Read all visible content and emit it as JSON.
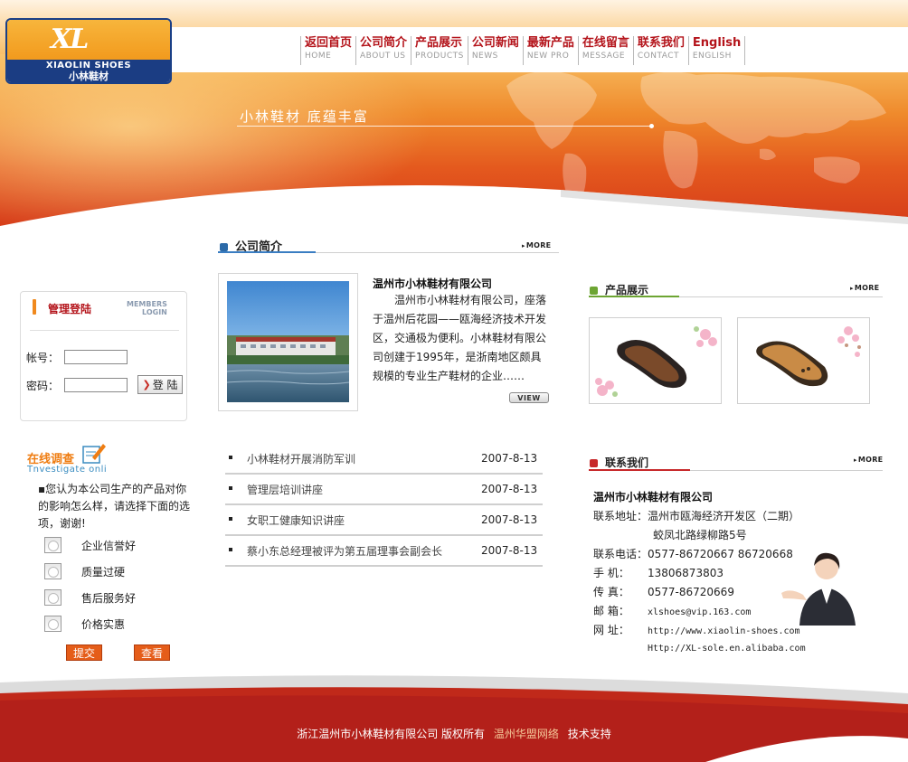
{
  "logo": {
    "mark": "XL",
    "en": "XIAOLIN SHOES",
    "cn": "小林鞋材"
  },
  "nav": [
    {
      "cn": "返回首页",
      "en": "HOME"
    },
    {
      "cn": "公司简介",
      "en": "ABOUT US"
    },
    {
      "cn": "产品展示",
      "en": "PRODUCTS"
    },
    {
      "cn": "公司新闻",
      "en": "NEWS"
    },
    {
      "cn": "最新产品",
      "en": "NEW PRO"
    },
    {
      "cn": "在线留言",
      "en": "MESSAGE"
    },
    {
      "cn": "联系我们",
      "en": "CONTACT"
    },
    {
      "cn": "English",
      "en": "ENGLISH"
    }
  ],
  "banner": {
    "slogan": "小林鞋材  底蕴丰富"
  },
  "login": {
    "title": "管理登陆",
    "sub_line1": "MEMBERS",
    "sub_line2": "LOGIN",
    "account_label": "帐号：",
    "password_label": "密码：",
    "submit_label": "登 陆"
  },
  "survey": {
    "title": "在线调查",
    "subtitle": "Tnvestigate onli",
    "question": "▪您认为本公司生产的产品对你的影响怎么样，请选择下面的选项，谢谢!",
    "options": [
      "企业信誉好",
      "质量过硬",
      "售后服务好",
      "价格实惠"
    ],
    "submit_label": "提交",
    "view_label": "查看"
  },
  "about": {
    "heading": "公司简介",
    "more": "MORE",
    "company": "温州市小林鞋材有限公司",
    "text": "温州市小林鞋材有限公司，座落于温州后花园——瓯海经济技术开发区，交通极为便利。小林鞋材有限公司创建于1995年，是浙南地区颇具规模的专业生产鞋材的企业……",
    "view_label": "VIEW"
  },
  "news": [
    {
      "title": "小林鞋材开展消防军训",
      "date": "2007-8-13"
    },
    {
      "title": "管理层培训讲座",
      "date": "2007-8-13"
    },
    {
      "title": "女职工健康知识讲座",
      "date": "2007-8-13"
    },
    {
      "title": "蔡小东总经理被评为第五届理事会副会长",
      "date": "2007-8-13"
    }
  ],
  "products": {
    "heading": "产品展示",
    "more": "MORE"
  },
  "contact": {
    "heading": "联系我们",
    "more": "MORE",
    "company": "温州市小林鞋材有限公司",
    "address_label": "联系地址：",
    "address_line1": "温州市瓯海经济开发区（二期）",
    "address_line2": "蛟凤北路绿柳路5号",
    "phone_label": "联系电话：",
    "phone": "0577-86720667  86720668",
    "mobile_label": "手    机：",
    "mobile": "13806873803",
    "fax_label": "传    真：",
    "fax": "0577-86720669",
    "email_label": "邮    箱：",
    "email": "xlshoes@vip.163.com",
    "web_label": "网    址：",
    "web1": "http://www.xiaolin-shoes.com",
    "web2": "Http://XL-sole.en.alibaba.com"
  },
  "footer": {
    "copyright": "浙江温州市小林鞋材有限公司 版权所有",
    "partner": "温州华盟网络",
    "support": "技术支持"
  },
  "colors": {
    "brand_red": "#b4141b",
    "banner_orange": "#ef8a2c",
    "footer_red": "#c0291a",
    "logo_blue": "#1b3d83"
  }
}
